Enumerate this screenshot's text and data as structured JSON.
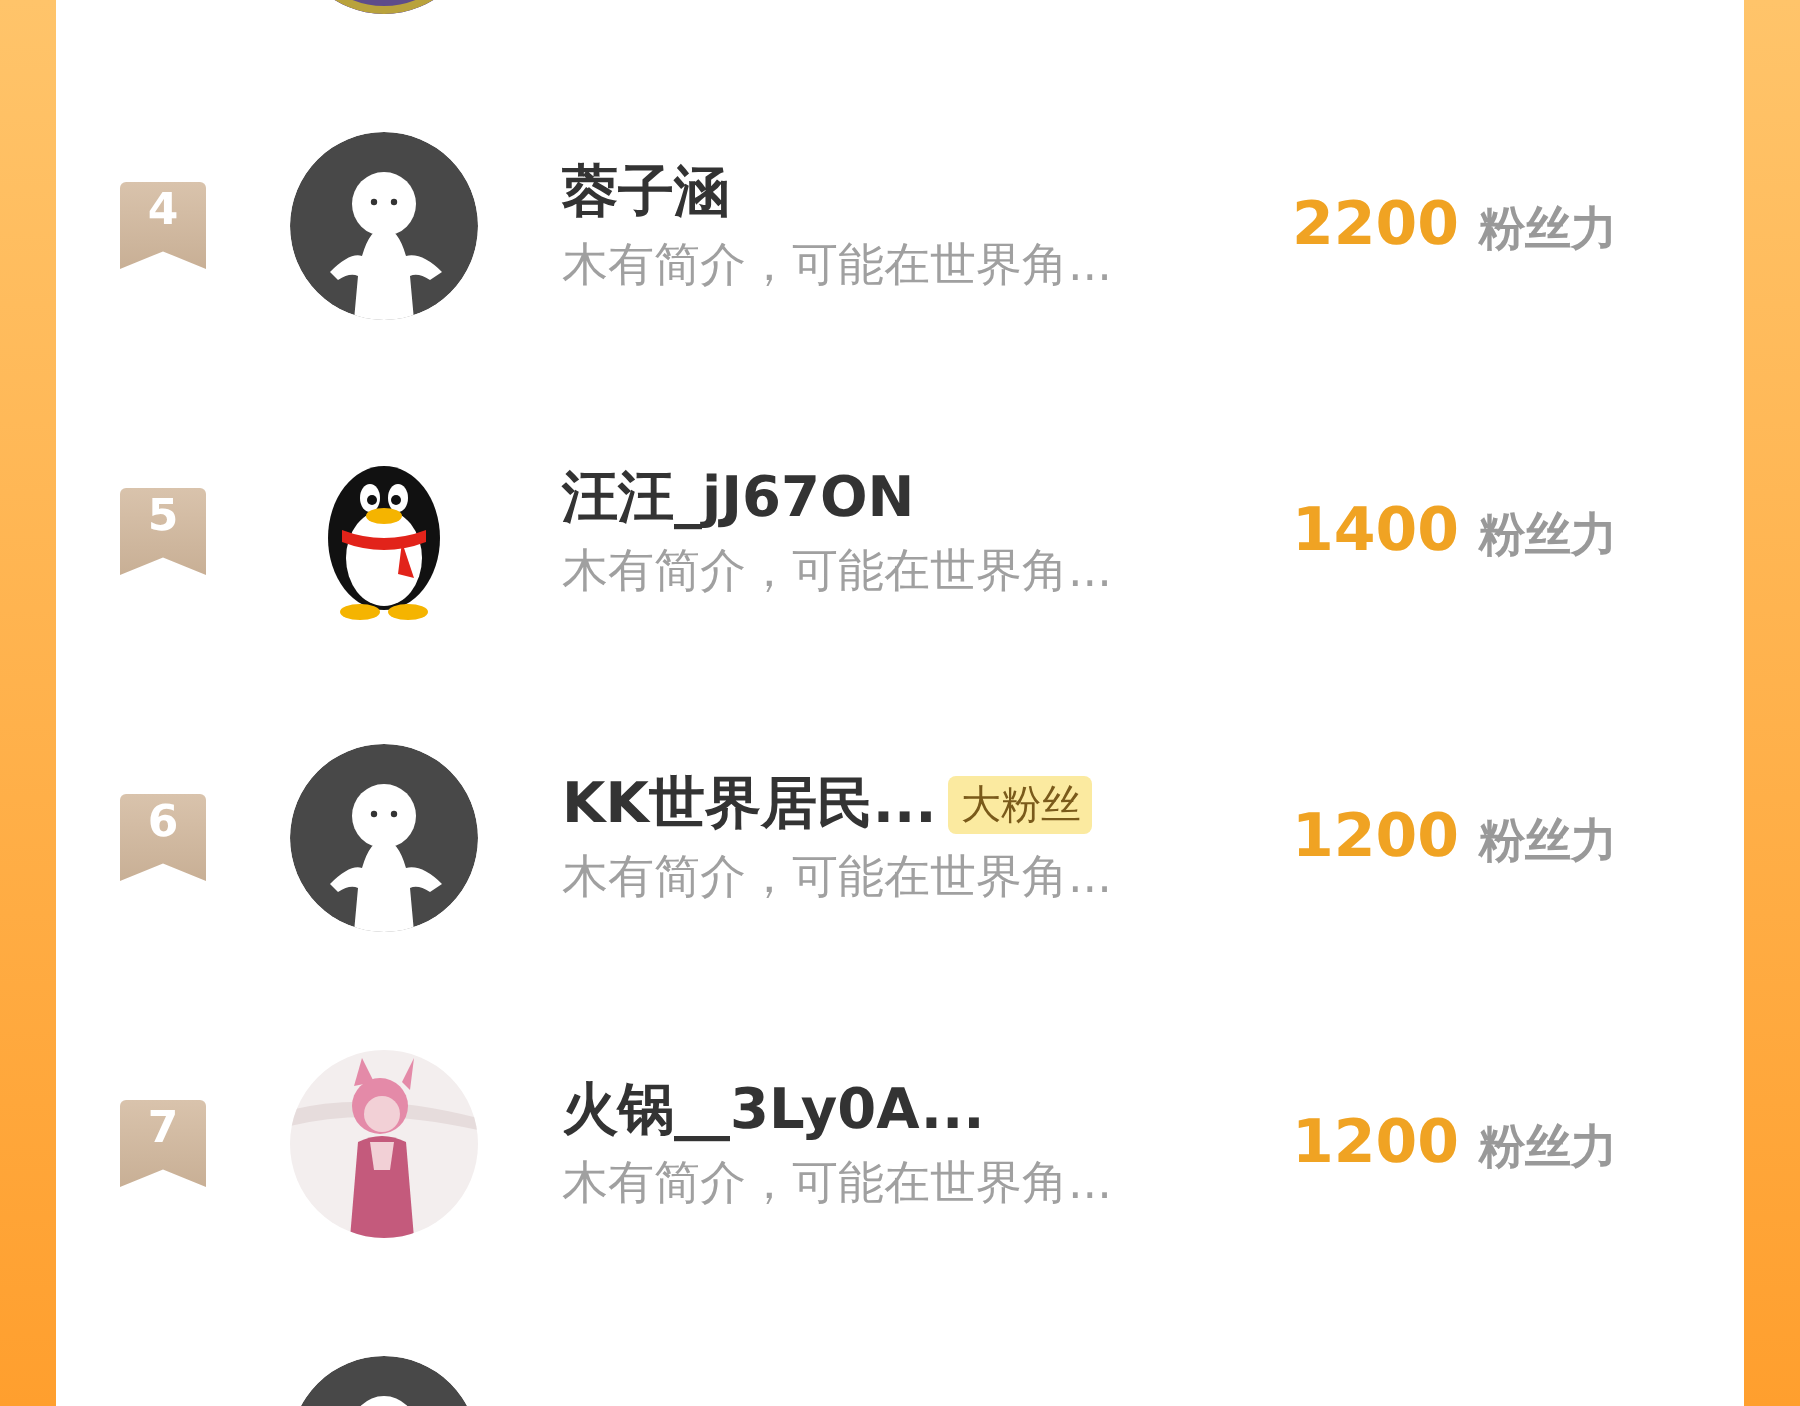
{
  "rows": [
    {
      "avatar": {
        "kind": "picture"
      }
    },
    {
      "rank": "4",
      "avatar": {
        "kind": "default"
      },
      "name": "蓉子涵",
      "bio": "木有简介，可能在世界角...",
      "score": "2200",
      "unit": "粉丝力"
    },
    {
      "rank": "5",
      "avatar": {
        "kind": "penguin"
      },
      "name": "汪汪_jJ67ON",
      "bio": "木有简介，可能在世界角...",
      "score": "1400",
      "unit": "粉丝力"
    },
    {
      "rank": "6",
      "avatar": {
        "kind": "default"
      },
      "name": "KK世界居民...",
      "badge": "大粉丝",
      "bio": "木有简介，可能在世界角...",
      "score": "1200",
      "unit": "粉丝力"
    },
    {
      "rank": "7",
      "avatar": {
        "kind": "picture"
      },
      "name": "火锅__3Ly0A...",
      "bio": "木有简介，可能在世界角...",
      "score": "1200",
      "unit": "粉丝力"
    },
    {
      "avatar": {
        "kind": "default"
      }
    }
  ]
}
